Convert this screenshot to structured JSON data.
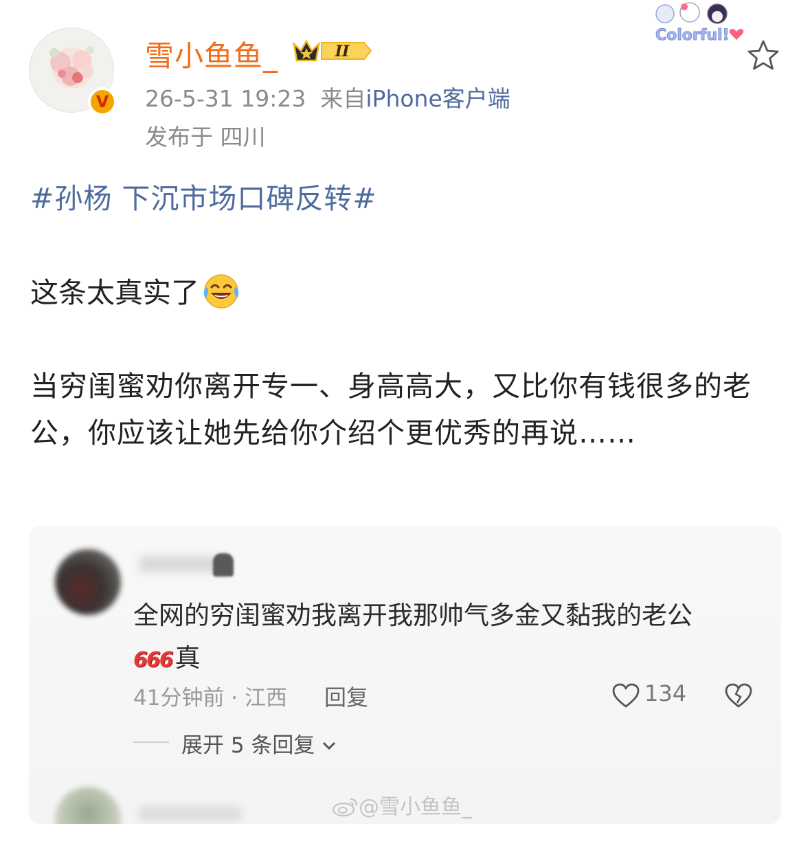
{
  "header": {
    "username": "雪小鱼鱼_",
    "vip_level": "II",
    "date_time": "26-5-31 19:23",
    "source_prefix": "来自",
    "source": "iPhone客户端",
    "location": "发布于 四川",
    "verified_badge": "V",
    "decoration_text": "Colorful!"
  },
  "post": {
    "hashtag": "#孙杨 下沉市场口碑反转#",
    "line1": "这条太真实了",
    "emoji": "laughing-tears-emoji",
    "paragraph": "当穷闺蜜劝你离开专一、身高高大，又比你有钱很多的老公，你应该让她先给你介绍个更优秀的再说……"
  },
  "embedded_comment": {
    "text_line1": "全网的穷闺蜜劝我离开我那帅气多金又黏我的老公",
    "badge_666": "666",
    "text_line2": "真",
    "time_location": "41分钟前 · 江西",
    "reply_label": "回复",
    "like_count": "134",
    "expand_label": "展开 5 条回复",
    "watermark": "@雪小鱼鱼_"
  },
  "colors": {
    "username": "#f26d19",
    "link": "#4e6b9e",
    "meta": "#8a8a8a",
    "text": "#222222"
  }
}
